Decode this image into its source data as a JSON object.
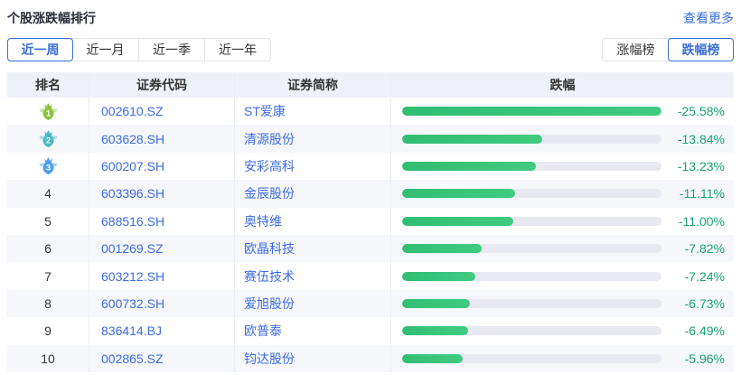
{
  "header": {
    "title": "个股涨跌幅排行",
    "more_link": "查看更多"
  },
  "period_tabs": {
    "items": [
      {
        "label": "近一周",
        "selected": true
      },
      {
        "label": "近一月",
        "selected": false
      },
      {
        "label": "近一季",
        "selected": false
      },
      {
        "label": "近一年",
        "selected": false
      }
    ]
  },
  "board_tabs": {
    "items": [
      {
        "label": "涨幅榜",
        "selected": false
      },
      {
        "label": "跌幅榜",
        "selected": true
      }
    ]
  },
  "table": {
    "columns": [
      "排名",
      "证券代码",
      "证券简称",
      "跌幅"
    ],
    "max_value": 25.58,
    "rows": [
      {
        "rank": 1,
        "code": "002610.SZ",
        "name": "ST爱康",
        "value": 25.58,
        "change_label": "-25.58%"
      },
      {
        "rank": 2,
        "code": "603628.SH",
        "name": "清源股份",
        "value": 13.84,
        "change_label": "-13.84%"
      },
      {
        "rank": 3,
        "code": "600207.SH",
        "name": "安彩高科",
        "value": 13.23,
        "change_label": "-13.23%"
      },
      {
        "rank": 4,
        "code": "603396.SH",
        "name": "金辰股份",
        "value": 11.11,
        "change_label": "-11.11%"
      },
      {
        "rank": 5,
        "code": "688516.SH",
        "name": "奥特维",
        "value": 11.0,
        "change_label": "-11.00%"
      },
      {
        "rank": 6,
        "code": "001269.SZ",
        "name": "欧晶科技",
        "value": 7.82,
        "change_label": "-7.82%"
      },
      {
        "rank": 7,
        "code": "603212.SH",
        "name": "赛伍技术",
        "value": 7.24,
        "change_label": "-7.24%"
      },
      {
        "rank": 8,
        "code": "600732.SH",
        "name": "爱旭股份",
        "value": 6.73,
        "change_label": "-6.73%"
      },
      {
        "rank": 9,
        "code": "836414.BJ",
        "name": "欧普泰",
        "value": 6.49,
        "change_label": "-6.49%"
      },
      {
        "rank": 10,
        "code": "002865.SZ",
        "name": "钧达股份",
        "value": 5.96,
        "change_label": "-5.96%"
      }
    ]
  },
  "colors": {
    "accent_blue": "#3b6fd8",
    "link_blue": "#3c6be4",
    "percent_green": "#17a274",
    "bar_track": "#e8e9f1",
    "bar_fill_start": "#31bd72",
    "bar_fill_end": "#40cb81",
    "medals": [
      {
        "body": "#8cc23f",
        "wing": "#c9e5a0"
      },
      {
        "body": "#47bac5",
        "wing": "#aadde2"
      },
      {
        "body": "#4f9ff2",
        "wing": "#b0d6fa"
      }
    ]
  }
}
